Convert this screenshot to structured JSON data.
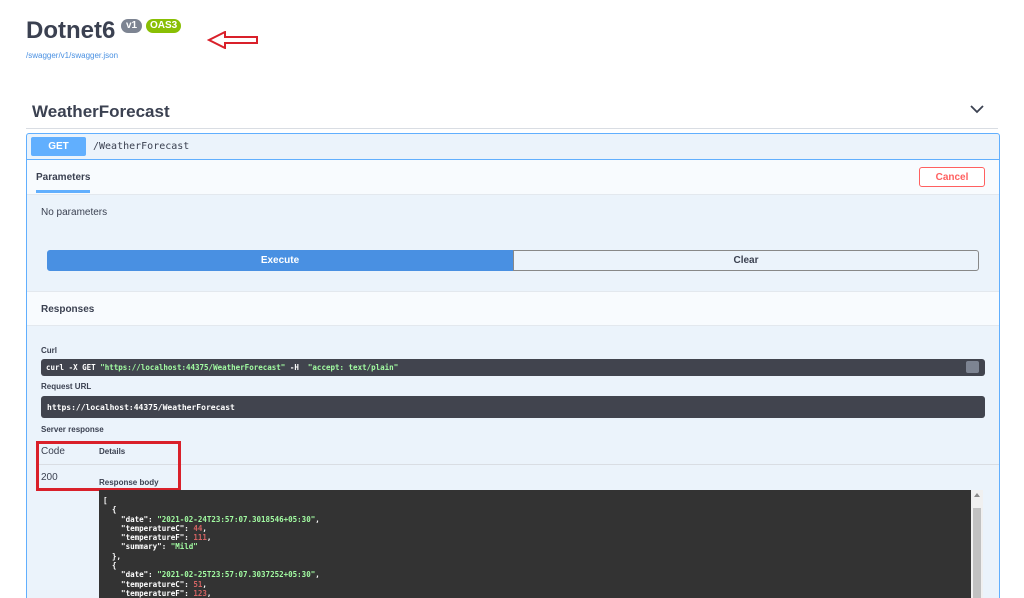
{
  "info": {
    "title": "Dotnet6",
    "version_badge": "v1",
    "oas_badge": "OAS3",
    "spec_link": "/swagger/v1/swagger.json"
  },
  "tag": {
    "title": "WeatherForecast"
  },
  "operation": {
    "method": "GET",
    "path": "/WeatherForecast",
    "parameters_tab": "Parameters",
    "cancel_label": "Cancel",
    "no_parameters": "No parameters",
    "execute_label": "Execute",
    "clear_label": "Clear"
  },
  "responses": {
    "title": "Responses",
    "curl_label": "Curl",
    "curl_cmd": "curl -X GET ",
    "curl_url": "\"https://localhost:44375/WeatherForecast\"",
    "curl_flag": " -H  ",
    "curl_header": "\"accept: text/plain\"",
    "request_url_label": "Request URL",
    "request_url": "https://localhost:44375/WeatherForecast",
    "server_response_label": "Server response",
    "code_header": "Code",
    "details_header": "Details",
    "code": "200",
    "response_body_label": "Response body",
    "body": {
      "open_bracket": "[",
      "items": [
        {
          "date": "\"2021-02-24T23:57:07.3018546+05:30\"",
          "temperatureC": "44",
          "temperatureF": "111",
          "summary": "\"Mild\""
        },
        {
          "date": "\"2021-02-25T23:57:07.3037252+05:30\"",
          "temperatureC": "51",
          "temperatureF": "123"
        }
      ]
    }
  },
  "colors": {
    "get_accent": "#61affe",
    "execute": "#4990e2",
    "cancel": "#ff6060",
    "annotation_red": "#d9202a",
    "oas_badge": "#89bf04"
  }
}
